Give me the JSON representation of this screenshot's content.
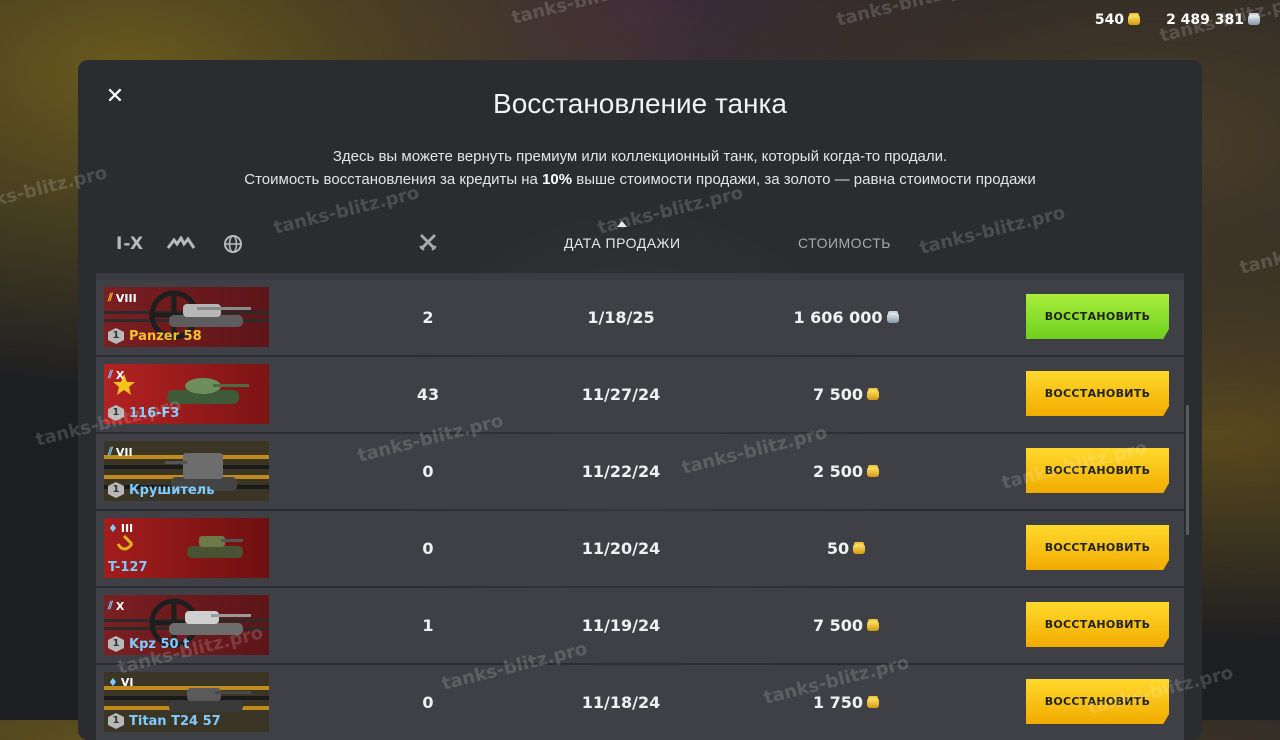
{
  "currency": {
    "gold": "540",
    "credits": "2 489 381"
  },
  "dialog": {
    "title": "Восстановление танка",
    "desc_line1": "Здесь вы можете вернуть премиум или коллекционный танк, который когда-то продали.",
    "desc_line2_pre": "Стоимость восстановления за кредиты на ",
    "desc_line2_bold": "10%",
    "desc_line2_post": " выше стоимости продажи, за золото — равна стоимости продажи",
    "close_icon": "close-icon"
  },
  "filters": {
    "tier_label": "I-X",
    "type_icon": "vehicle-type-icon",
    "nation_icon": "globe-icon"
  },
  "columns": {
    "battles_icon": "crossed-swords-icon",
    "date": "ДАТА ПРОДАЖИ",
    "price": "СТОИМОСТЬ"
  },
  "watermark": "tanks-blitz.pro",
  "colors": {
    "gold_button": "#ffc61a",
    "credit_button": "#8de030",
    "premium_name": "#f4c030",
    "collector_name": "#7ecbff"
  },
  "rows": [
    {
      "tier": "VIII",
      "name": "Panzer 58",
      "badge": "1",
      "count": "2",
      "date": "1/18/25",
      "price": "1 606 000",
      "currency": "credits",
      "button": "ВОССТАНОВИТЬ"
    },
    {
      "tier": "X",
      "name": "116-F3",
      "badge": "1",
      "count": "43",
      "date": "11/27/24",
      "price": "7 500",
      "currency": "gold",
      "button": "ВОССТАНОВИТЬ"
    },
    {
      "tier": "VII",
      "name": "Крушитель",
      "badge": "1",
      "count": "0",
      "date": "11/22/24",
      "price": "2 500",
      "currency": "gold",
      "button": "ВОССТАНОВИТЬ"
    },
    {
      "tier": "III",
      "name": "T-127",
      "badge": "",
      "count": "0",
      "date": "11/20/24",
      "price": "50",
      "currency": "gold",
      "button": "ВОССТАНОВИТЬ"
    },
    {
      "tier": "X",
      "name": "Kpz 50 t",
      "badge": "1",
      "count": "1",
      "date": "11/19/24",
      "price": "7 500",
      "currency": "gold",
      "button": "ВОССТАНОВИТЬ"
    },
    {
      "tier": "VI",
      "name": "Titan T24 57",
      "badge": "1",
      "count": "0",
      "date": "11/18/24",
      "price": "1 750",
      "currency": "gold",
      "button": "ВОССТАНОВИТЬ"
    }
  ]
}
